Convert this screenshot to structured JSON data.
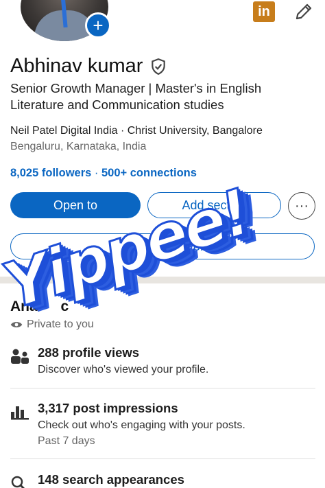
{
  "profile": {
    "name": "Abhinav kumar",
    "headline": "Senior Growth Manager | Master's in English Literature and Communication studies",
    "company_line": "Neil Patel Digital India · Christ University, Bangalore",
    "location": "Bengaluru, Karnataka, India",
    "followers": "8,025 followers",
    "separator": "·",
    "connections": "500+ connections"
  },
  "header": {
    "add_photo_icon": "+",
    "linkedin_badge": "in"
  },
  "actions": {
    "open_to": "Open to",
    "add_section": "Add section",
    "more": "···",
    "custom_button": "button"
  },
  "analytics": {
    "title": "Analytics",
    "title_visible": "Anal",
    "title_tail": "c",
    "visibility": "Private to you",
    "metrics": [
      {
        "icon": "people-icon",
        "title": "288 profile views",
        "desc": "Discover who's viewed your profile.",
        "sub": ""
      },
      {
        "icon": "bar-chart-icon",
        "title": "3,317 post impressions",
        "desc": "Check out who's engaging with your posts.",
        "sub": "Past 7 days"
      },
      {
        "icon": "search-icon",
        "title": "148 search appearances",
        "desc": "",
        "sub": ""
      }
    ]
  },
  "sticker": {
    "text": "Yippee!"
  },
  "colors": {
    "accent": "#0a66c2",
    "sticker": "#1e4fd8",
    "linkedin_badge": "#c77d1b"
  }
}
